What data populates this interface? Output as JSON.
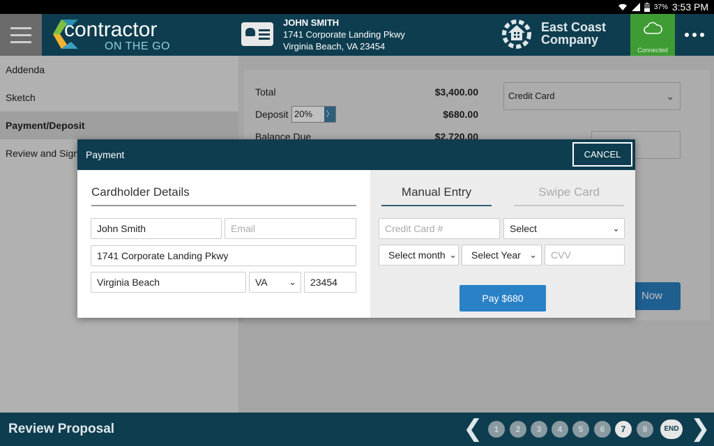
{
  "status_bar": {
    "battery": "37%",
    "time": "3:53 PM"
  },
  "header": {
    "logo_word": "contractor",
    "logo_tagline": "ON THE GO",
    "customer": {
      "name": "JOHN SMITH",
      "address1": "1741 Corporate Landing Pkwy",
      "address2": "Virginia Beach, VA 23454"
    },
    "company": {
      "line1": "East Coast",
      "line2": "Company"
    },
    "connection_status": "Connected"
  },
  "sidebar": {
    "items": [
      {
        "label": "Addenda"
      },
      {
        "label": "Sketch"
      },
      {
        "label": "Payment/Deposit",
        "active": true
      },
      {
        "label": "Review and Sign"
      }
    ]
  },
  "summary": {
    "total_label": "Total",
    "total_value": "$3,400.00",
    "deposit_label": "Deposit",
    "deposit_percent": "20%",
    "deposit_value": "$680.00",
    "balance_label": "Balance Due",
    "balance_value": "$2,720.00",
    "payment_method": "Credit Card",
    "pay_now_fragment": "Now"
  },
  "modal": {
    "title": "Payment",
    "cancel_label": "CANCEL",
    "cardholder": {
      "section_title": "Cardholder Details",
      "name_value": "John Smith",
      "email_placeholder": "Email",
      "address_value": "1741 Corporate Landing Pkwy",
      "city_value": "Virginia Beach",
      "state_value": "VA",
      "zip_value": "23454"
    },
    "card": {
      "tab_manual": "Manual Entry",
      "tab_swipe": "Swipe Card",
      "card_number_placeholder": "Credit Card #",
      "card_type_value": "Select",
      "month_value": "Select month",
      "year_value": "Select Year",
      "cvv_placeholder": "CVV",
      "pay_label": "Pay $680"
    }
  },
  "footer": {
    "title": "Review Proposal",
    "pages": [
      "1",
      "2",
      "3",
      "4",
      "5",
      "6",
      "7",
      "8"
    ],
    "current_page": "7",
    "end_label": "END"
  },
  "colors": {
    "header_bg": "#0e3d4f",
    "connected_bg": "#3f9c35",
    "button_blue": "#2a82c6"
  }
}
